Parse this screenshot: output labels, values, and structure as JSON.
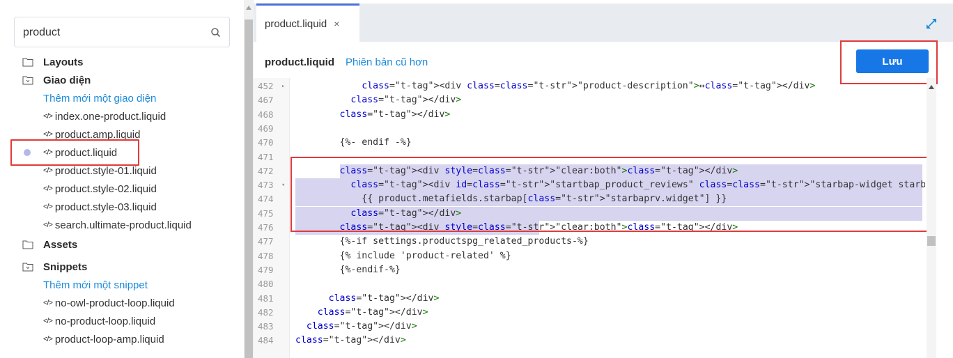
{
  "sidebar": {
    "search": {
      "value": "product",
      "placeholder": ""
    },
    "folders": {
      "layouts": "Layouts",
      "templates": "Giao diện",
      "templates_add": "Thêm mới một giao diện",
      "assets": "Assets",
      "snippets": "Snippets",
      "snippets_add": "Thêm mới một snippet"
    },
    "template_files": [
      "index.one-product.liquid",
      "product.amp.liquid",
      "product.liquid",
      "product.style-01.liquid",
      "product.style-02.liquid",
      "product.style-03.liquid",
      "search.ultimate-product.liquid"
    ],
    "snippet_files": [
      "no-owl-product-loop.liquid",
      "no-product-loop.liquid",
      "product-loop-amp.liquid"
    ],
    "file_tag": "</>"
  },
  "editor": {
    "tab_label": "product.liquid",
    "tab_close": "×",
    "file_name": "product.liquid",
    "old_version": "Phiên bản cũ hơn",
    "save_label": "Lưu"
  },
  "colors": {
    "accent": "#1877e6",
    "link": "#1b8adb",
    "highlight_box": "#e03b3b",
    "selection": "#d7d4f0"
  },
  "code_lines": [
    {
      "num": "452",
      "fold": "▸",
      "text": "            <div class=\"product-description\">↔</div>"
    },
    {
      "num": "467",
      "fold": "",
      "text": "          </div>"
    },
    {
      "num": "468",
      "fold": "",
      "text": "        </div>"
    },
    {
      "num": "469",
      "fold": "",
      "text": ""
    },
    {
      "num": "470",
      "fold": "",
      "text": "        {%- endif -%}"
    },
    {
      "num": "471",
      "fold": "",
      "text": ""
    },
    {
      "num": "472",
      "fold": "",
      "text": "        <div style=\"clear:both\"></div>"
    },
    {
      "num": "473",
      "fold": "▾",
      "text": "          <div id=\"startbap_product_reviews\" class=\"starbap-widget starbap-review-widget\" data-product"
    },
    {
      "num": "474",
      "fold": "",
      "text": "            {{ product.metafields.starbap[\"starbaprv.widget\"] }}"
    },
    {
      "num": "475",
      "fold": "",
      "text": "          </div>"
    },
    {
      "num": "476",
      "fold": "",
      "text": "        <div style=\"clear:both\"></div>"
    },
    {
      "num": "477",
      "fold": "",
      "text": "        {%-if settings.productspg_related_products-%}"
    },
    {
      "num": "478",
      "fold": "",
      "text": "        {% include 'product-related' %}"
    },
    {
      "num": "479",
      "fold": "",
      "text": "        {%-endif-%}"
    },
    {
      "num": "480",
      "fold": "",
      "text": ""
    },
    {
      "num": "481",
      "fold": "",
      "text": "      </div>"
    },
    {
      "num": "482",
      "fold": "",
      "text": "    </div>"
    },
    {
      "num": "483",
      "fold": "",
      "text": "  </div>"
    },
    {
      "num": "484",
      "fold": "",
      "text": "</div>"
    }
  ]
}
